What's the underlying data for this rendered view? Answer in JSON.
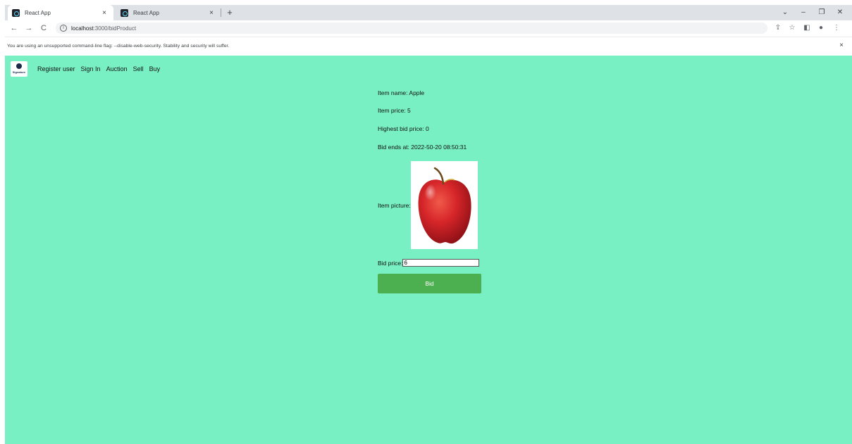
{
  "browser": {
    "tabs": [
      {
        "title": "React App",
        "close": "×"
      },
      {
        "title": "React App",
        "close": "×"
      }
    ],
    "new_tab": "+",
    "window_controls": {
      "tab_search": "⌄",
      "minimize": "–",
      "restore": "❐",
      "close": "✕"
    },
    "nav": {
      "back": "←",
      "forward": "→",
      "reload": "C"
    },
    "url_host": "localhost",
    "url_path": ":3000/bidProduct",
    "toolbar_icons": {
      "share": "⇪",
      "star": "☆",
      "sidepanel": "◧",
      "profile": "●",
      "menu": "⋮"
    },
    "warning": "You are using an unsupported command-line flag: --disable-web-security. Stability and security will suffer.",
    "warning_close": "×"
  },
  "logo": {
    "text": "Signature"
  },
  "nav_links": [
    "Register user",
    "Sign In",
    "Auction",
    "Sell",
    "Buy"
  ],
  "item": {
    "name": "Item name: Apple",
    "price": "Item price: 5",
    "highest_bid": "Highest bid price: 0",
    "ends_at": "Bid ends at: 2022-50-20 08:50:31",
    "picture_label": "Item picture:",
    "bid_label": "Bid price:",
    "bid_value": "6",
    "bid_button": "Bid"
  },
  "colors": {
    "page_bg": "#79f0c4",
    "button_bg": "#4caf50",
    "chrome_bg": "#dee1e6"
  }
}
